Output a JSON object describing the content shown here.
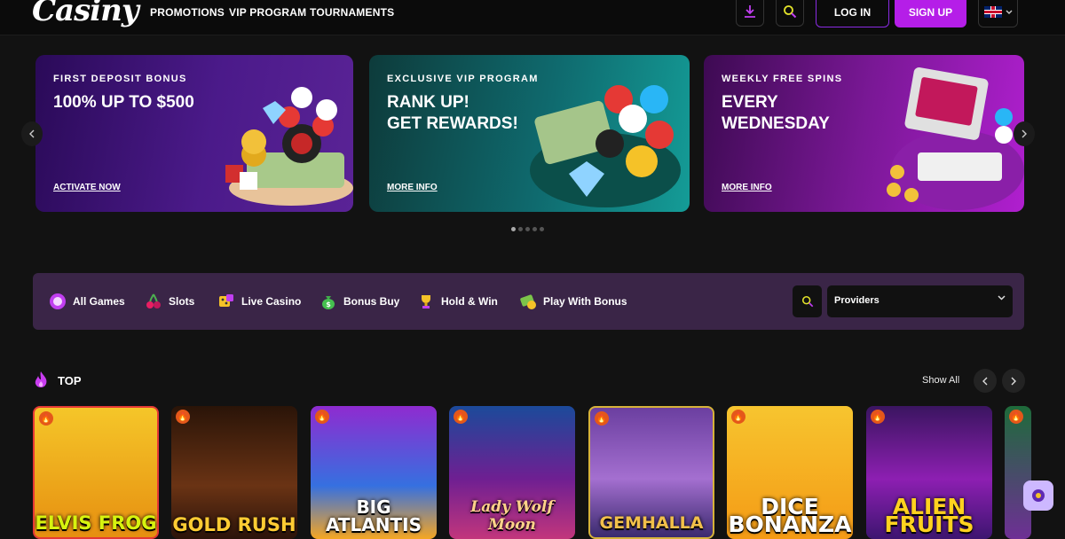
{
  "header": {
    "logo": "Casiny",
    "nav": [
      "PROMOTIONS",
      "VIP PROGRAM",
      "TOURNAMENTS"
    ],
    "login_label": "LOG IN",
    "signup_label": "SIGN UP",
    "icons": [
      "download-icon",
      "search-icon",
      "uk-flag-icon",
      "chevron-down-icon"
    ]
  },
  "banners": [
    {
      "kicker": "FIRST DEPOSIT BONUS",
      "title": "100% UP TO $500",
      "link": "ACTIVATE NOW"
    },
    {
      "kicker": "EXCLUSIVE VIP PROGRAM",
      "title": "RANK UP!\nGET REWARDS!",
      "link": "MORE INFO"
    },
    {
      "kicker": "WEEKLY FREE SPINS",
      "title": "EVERY\nWEDNESDAY",
      "link": "MORE INFO"
    }
  ],
  "carousel": {
    "dots": 5,
    "active_dot": 1
  },
  "categories": [
    {
      "label": "All Games",
      "icon": "chip-icon"
    },
    {
      "label": "Slots",
      "icon": "cherry-icon"
    },
    {
      "label": "Live Casino",
      "icon": "dice-icon"
    },
    {
      "label": "Bonus Buy",
      "icon": "money-bag-icon"
    },
    {
      "label": "Hold & Win",
      "icon": "trophy-icon"
    },
    {
      "label": "Play With Bonus",
      "icon": "bonus-icon"
    }
  ],
  "providers": {
    "label": "Providers"
  },
  "top_section": {
    "title": "TOP",
    "show_all": "Show All"
  },
  "games": [
    {
      "name": "ELVIS FROG"
    },
    {
      "name": "GOLD RUSH"
    },
    {
      "name": "BIG ATLANTIS"
    },
    {
      "name": "Lady Wolf Moon"
    },
    {
      "name": "GEMHALLA"
    },
    {
      "name": "DICE BONANZA"
    },
    {
      "name": "ALIEN FRUITS"
    }
  ],
  "colors": {
    "accent": "#b51ee8",
    "filter_bg": "#3a2547",
    "page_bg": "#121212"
  }
}
